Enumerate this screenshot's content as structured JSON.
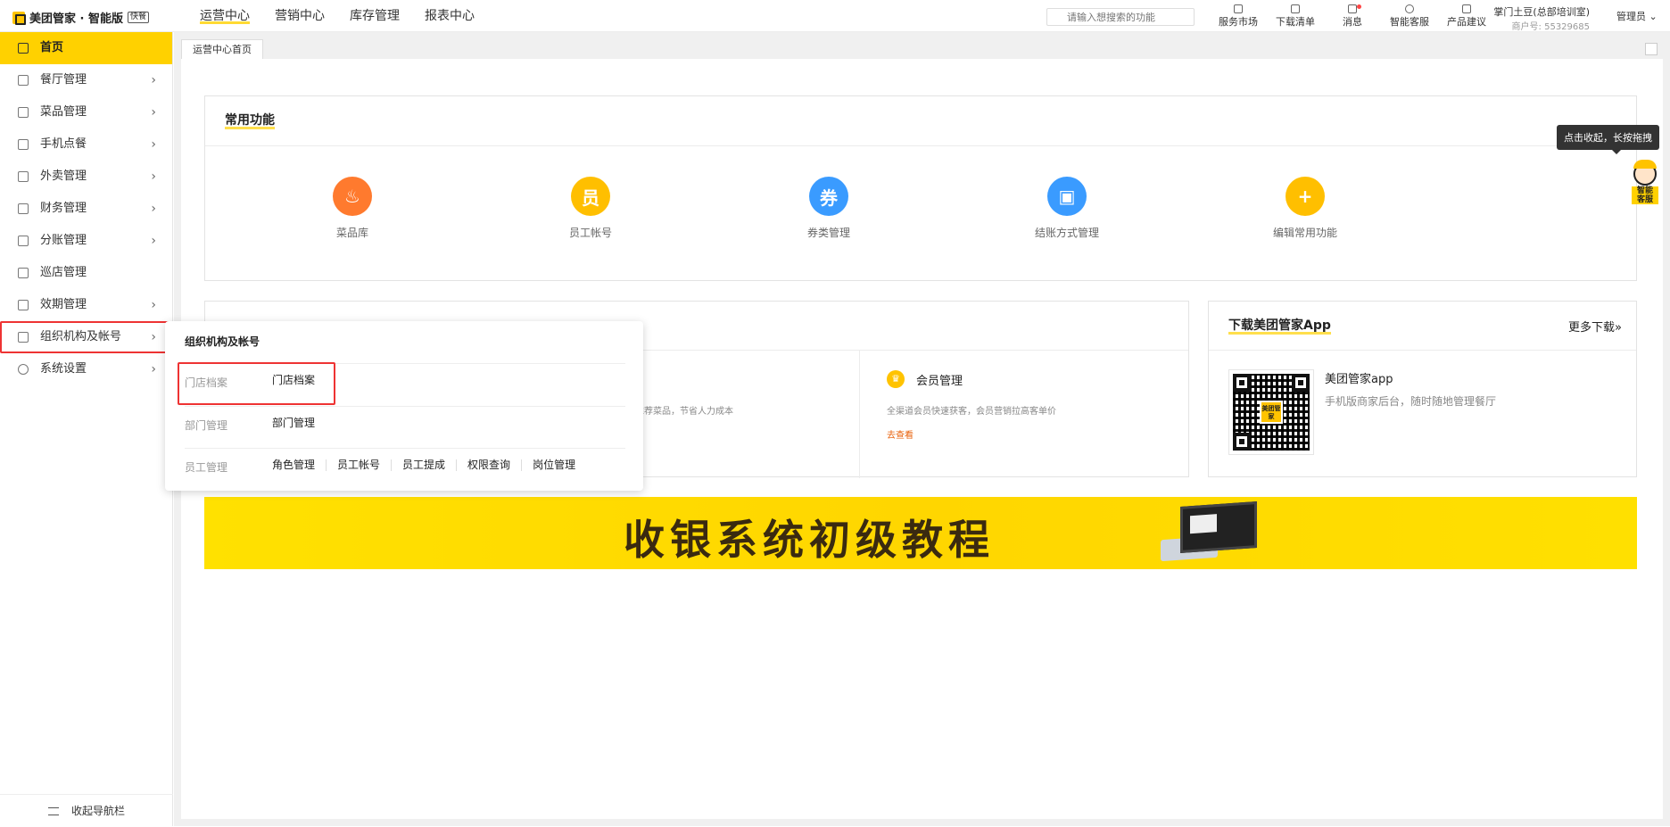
{
  "app": {
    "brand": "美团管家 · 智能版",
    "badge": "快餐"
  },
  "topnav": [
    "运营中心",
    "营销中心",
    "库存管理",
    "报表中心"
  ],
  "search": {
    "placeholder": "请输入想搜索的功能"
  },
  "tools": [
    {
      "label": "服务市场",
      "icon": "cart-icon"
    },
    {
      "label": "下载清单",
      "icon": "download-icon"
    },
    {
      "label": "消息",
      "icon": "bell-icon"
    },
    {
      "label": "智能客服",
      "icon": "help-icon"
    },
    {
      "label": "产品建议",
      "icon": "feedback-icon"
    }
  ],
  "store": {
    "name": "掌门土豆(总部培训室)",
    "id": "商户号: 55329685"
  },
  "admin": {
    "label": "管理员"
  },
  "sidebar": {
    "items": [
      {
        "label": "首页",
        "icon": "home-icon"
      },
      {
        "label": "餐厅管理",
        "icon": "restaurant-icon"
      },
      {
        "label": "菜品管理",
        "icon": "dish-icon"
      },
      {
        "label": "手机点餐",
        "icon": "phone-icon"
      },
      {
        "label": "外卖管理",
        "icon": "delivery-icon"
      },
      {
        "label": "财务管理",
        "icon": "finance-icon"
      },
      {
        "label": "分账管理",
        "icon": "split-icon"
      },
      {
        "label": "巡店管理",
        "icon": "inspect-icon"
      },
      {
        "label": "效期管理",
        "icon": "calendar-icon"
      },
      {
        "label": "组织机构及帐号",
        "icon": "org-icon"
      },
      {
        "label": "系统设置",
        "icon": "settings-icon"
      }
    ],
    "collapse": "收起导航栏"
  },
  "tab": {
    "label": "运营中心首页"
  },
  "common": {
    "title": "常用功能",
    "items": [
      {
        "label": "菜品库",
        "glyph": "♨",
        "color": "#ff7a2e"
      },
      {
        "label": "员工帐号",
        "glyph": "员",
        "color": "#ffbf00"
      },
      {
        "label": "券类管理",
        "glyph": "券",
        "color": "#3a9bff"
      },
      {
        "label": "结账方式管理",
        "glyph": "▣",
        "color": "#3a9bff"
      },
      {
        "label": "编辑常用功能",
        "glyph": "+",
        "color": "#ffbf00"
      }
    ]
  },
  "middle": {
    "partial_desc": "推荐菜品，节省人力成本",
    "member": {
      "title": "会员管理",
      "desc": "全渠道会员快速获客，会员营销拉高客单价",
      "link": "去查看",
      "icon": "crown-icon"
    }
  },
  "download": {
    "title": "下载美团管家App",
    "more": "更多下载»",
    "app_name": "美团管家app",
    "app_desc": "手机版商家后台，随时随地管理餐厅",
    "qr_logo": "美团管家"
  },
  "banner": {
    "text": "收银系统初级教程"
  },
  "popup": {
    "title": "组织机构及帐号",
    "rows": [
      {
        "label": "门店档案",
        "links": [
          "门店档案"
        ]
      },
      {
        "label": "部门管理",
        "links": [
          "部门管理"
        ]
      },
      {
        "label": "员工管理",
        "links": [
          "角色管理",
          "员工帐号",
          "员工提成",
          "权限查询",
          "岗位管理"
        ]
      }
    ]
  },
  "float": {
    "tooltip": "点击收起，长按拖拽",
    "bot_label_1": "智能",
    "bot_label_2": "客服"
  }
}
